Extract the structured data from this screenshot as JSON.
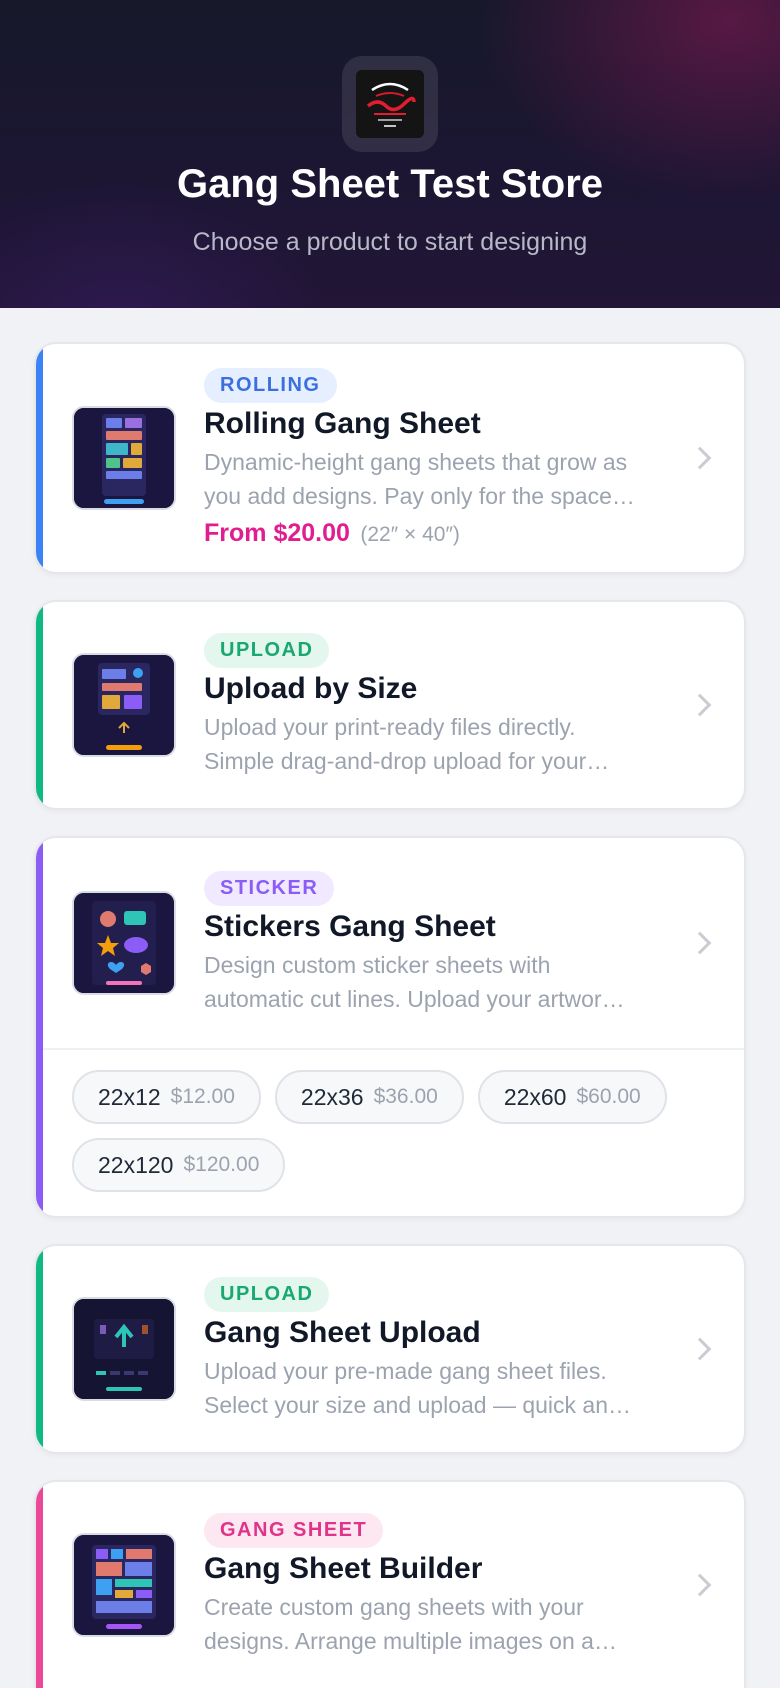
{
  "header": {
    "store_title": "Gang Sheet Test Store",
    "subtitle": "Choose a product to start designing",
    "logo_icon": "store-logo"
  },
  "products": [
    {
      "badge": "ROLLING",
      "title": "Rolling Gang Sheet",
      "desc_line1": "Dynamic-height gang sheets that grow as",
      "desc_line2": "you add designs. Pay only for the space…",
      "price": "From $20.00",
      "dims": "(22″ × 40″)",
      "accent": "#3b82f6",
      "badge_bg": "#e6efff",
      "badge_fg": "#3b6fe0"
    },
    {
      "badge": "UPLOAD",
      "title": "Upload by Size",
      "desc_line1": "Upload your print-ready files directly.",
      "desc_line2": "Simple drag-and-drop upload for your…",
      "accent": "#10b981",
      "badge_bg": "#e3f7ee",
      "badge_fg": "#18a870"
    },
    {
      "badge": "STICKER",
      "title": "Stickers Gang Sheet",
      "desc_line1": "Design custom sticker sheets with",
      "desc_line2": "automatic cut lines. Upload your artwor…",
      "accent": "#8b5cf6",
      "badge_bg": "#f0e9ff",
      "badge_fg": "#8b5cf6",
      "sizes": [
        {
          "size": "22x12",
          "price": "$12.00"
        },
        {
          "size": "22x36",
          "price": "$36.00"
        },
        {
          "size": "22x60",
          "price": "$60.00"
        },
        {
          "size": "22x120",
          "price": "$120.00"
        }
      ]
    },
    {
      "badge": "UPLOAD",
      "title": "Gang Sheet Upload",
      "desc_line1": "Upload your pre-made gang sheet files.",
      "desc_line2": "Select your size and upload — quick an…",
      "accent": "#10b981",
      "badge_bg": "#e3f7ee",
      "badge_fg": "#18a870"
    },
    {
      "badge": "GANG SHEET",
      "title": "Gang Sheet Builder",
      "desc_line1": "Create custom gang sheets with your",
      "desc_line2": "designs. Arrange multiple images on a…",
      "accent": "#ec4899",
      "badge_bg": "#fde7f1",
      "badge_fg": "#e0338a"
    }
  ]
}
